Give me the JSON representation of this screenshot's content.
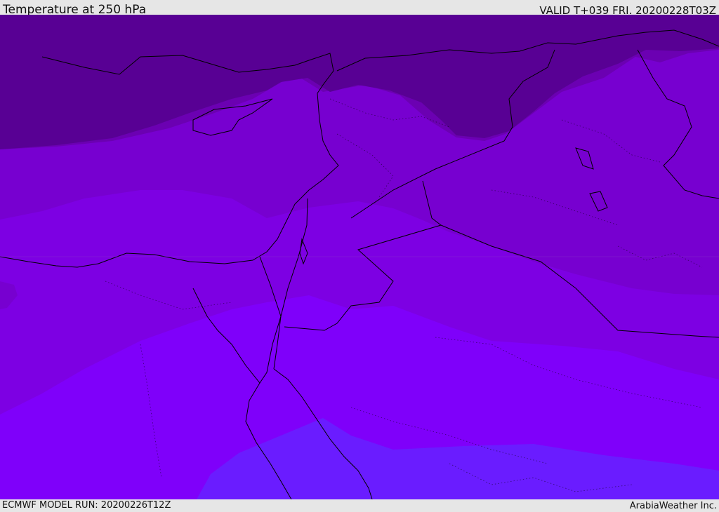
{
  "header": {
    "title": "Temperature at 250 hPa",
    "valid": "VALID T+039 FRI. 20200228T03Z"
  },
  "footer": {
    "model_run": "ECMWF MODEL RUN: 20200226T12Z",
    "brand": "ArabiaWeather Inc."
  },
  "map": {
    "variable": "Temperature",
    "level": "250 hPa",
    "colors": {
      "band1": "#580094",
      "band2": "#6b00b2",
      "band3": "#7700d0",
      "band4": "#7d00e3",
      "band5": "#7f00fa",
      "band6": "#6a1cff",
      "coastline": "#000000"
    }
  }
}
